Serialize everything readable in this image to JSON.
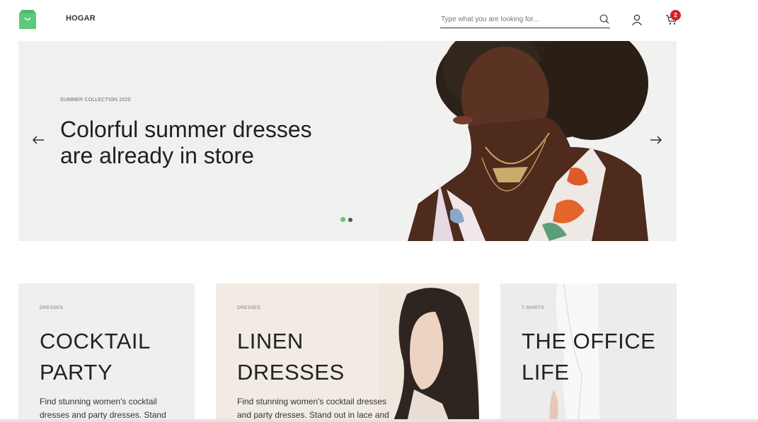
{
  "header": {
    "brand": "HOGAR",
    "search_placeholder": "Type what you are looking for...",
    "cart_count": "2",
    "brand_color": "#5dc97b",
    "badge_color": "#d3222a"
  },
  "hero": {
    "eyebrow": "SUMMER COLLECTION 2020",
    "title_line1": "Colorful summer dresses",
    "title_line2": "are already in store",
    "slide_count": 2,
    "active_slide": 1
  },
  "cards": [
    {
      "category": "DRESSES",
      "title": "COCKTAIL\nPARTY",
      "text": "Find stunning women's cocktail dresses and party dresses. Stand"
    },
    {
      "category": "DRESSES",
      "title": "LINEN\nDRESSES",
      "text": "Find stunning women's cocktail dresses and party dresses. Stand out in lace and"
    },
    {
      "category": "T-SHIRTS",
      "title": "THE OFFICE\nLIFE",
      "text": ""
    }
  ],
  "icons": {
    "logo": "shopping-bag-logo-icon",
    "search": "search-icon",
    "user": "user-icon",
    "cart": "cart-icon",
    "prev": "arrow-left-icon",
    "next": "arrow-right-icon"
  }
}
